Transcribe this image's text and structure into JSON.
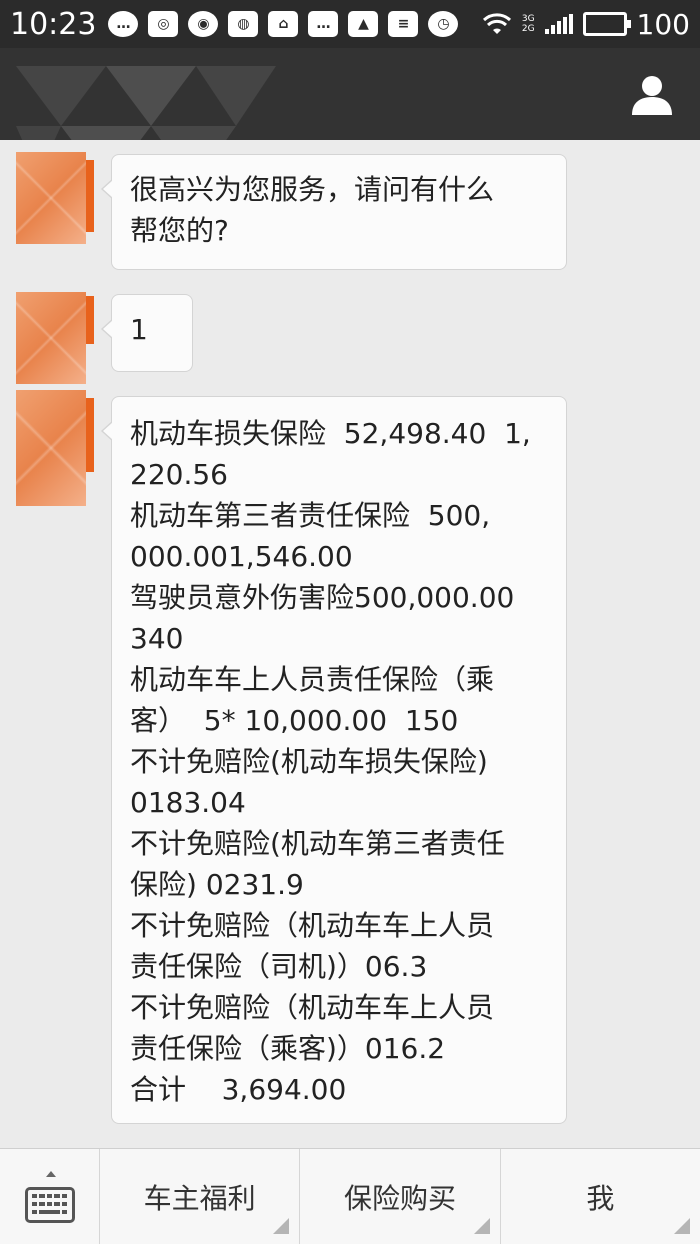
{
  "status_bar": {
    "time": "10:23",
    "network_top": "3G",
    "network_bottom": "2G",
    "battery": "100"
  },
  "chat": {
    "messages": [
      {
        "from": "agent",
        "lines": [
          "很高兴为您服务，请问有什么",
          "帮您的?"
        ]
      },
      {
        "from": "agent",
        "lines": [
          "1"
        ]
      },
      {
        "from": "agent",
        "lines": [
          "机动车损失保险  52,498.40  1,",
          "220.56",
          "机动车第三者责任保险  500,",
          "000.001,546.00",
          "驾驶员意外伤害险500,000.00",
          "340",
          "机动车车上人员责任保险（乘",
          "客）  5* 10,000.00  150",
          "不计免赔险(机动车损失保险)",
          "0183.04",
          "不计免赔险(机动车第三者责任",
          "保险) 0231.9",
          "不计免赔险（机动车车上人员",
          "责任保险（司机)）06.3",
          "不计免赔险（机动车车上人员",
          "责任保险（乘客)）016.2",
          "合计    3,694.00"
        ]
      }
    ]
  },
  "bottom_bar": {
    "keyboard_icon": "keyboard-icon",
    "menu": [
      {
        "label": "车主福利"
      },
      {
        "label": "保险购买"
      },
      {
        "label": "我"
      }
    ]
  }
}
